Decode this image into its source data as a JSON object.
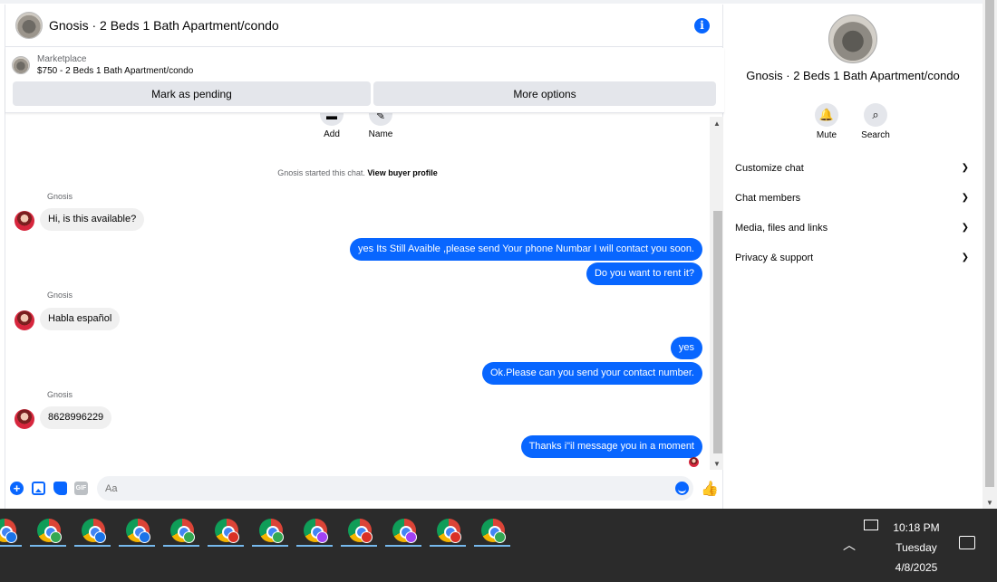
{
  "header": {
    "title": "Gnosis · 2 Beds 1 Bath Apartment/condo",
    "info_icon": "info-icon"
  },
  "listing": {
    "kind": "Marketplace",
    "price_title": "$750 - 2 Beds 1 Bath Apartment/condo",
    "mark_pending_label": "Mark as pending",
    "more_options_label": "More options"
  },
  "quick_actions": {
    "add_label": "Add",
    "name_label": "Name"
  },
  "chat_started": {
    "text": "Gnosis started this chat.",
    "link": "View buyer profile"
  },
  "messages": [
    {
      "from": "Gnosis",
      "direction": "in",
      "text": "Hi, is this available?"
    },
    {
      "from": "me",
      "direction": "out",
      "text": "yes Its Still Avaible ,please send Your phone Numbar I will contact you soon."
    },
    {
      "from": "me",
      "direction": "out",
      "text": "Do you want to rent it?"
    },
    {
      "from": "Gnosis",
      "direction": "in",
      "text": "Habla español"
    },
    {
      "from": "me",
      "direction": "out",
      "text": "yes"
    },
    {
      "from": "me",
      "direction": "out",
      "text": "Ok.Please can you send your contact number."
    },
    {
      "from": "Gnosis",
      "direction": "in",
      "text": "8628996229"
    },
    {
      "from": "me",
      "direction": "out",
      "text": "Thanks i\"il message you in a moment"
    }
  ],
  "composer": {
    "placeholder": "Aa"
  },
  "details": {
    "title": "Gnosis · 2 Beds 1 Bath Apartment/condo",
    "mute_label": "Mute",
    "search_label": "Search",
    "sections": [
      "Customize chat",
      "Chat members",
      "Media, files and links",
      "Privacy & support"
    ]
  },
  "taskbar": {
    "time": "10:18 PM",
    "day": "Tuesday",
    "date": "4/8/2025",
    "app_badge_colors": [
      "#1a73e8",
      "#34a853",
      "#1a73e8",
      "#1a73e8",
      "#34a853",
      "#d93025",
      "#34a853",
      "#a142f4",
      "#d93025",
      "#a142f4",
      "#d93025",
      "#34a853"
    ]
  },
  "colors": {
    "accent": "#0866ff",
    "incoming_bubble": "#f0f0f0",
    "taskbar": "#2b2b2b"
  }
}
